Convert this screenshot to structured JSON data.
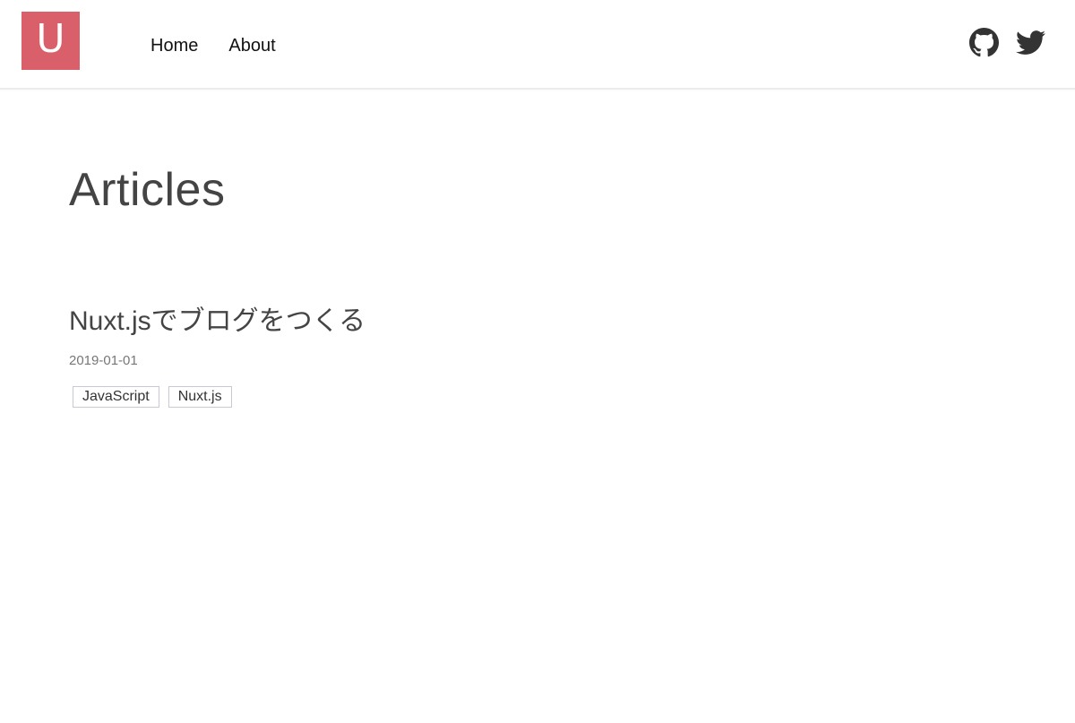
{
  "header": {
    "logo_letter": "U",
    "brand_color": "#d9606a",
    "nav": [
      {
        "label": "Home"
      },
      {
        "label": "About"
      }
    ],
    "social": [
      {
        "icon": "github-icon"
      },
      {
        "icon": "twitter-icon"
      }
    ]
  },
  "main": {
    "title": "Articles",
    "articles": [
      {
        "title": "Nuxt.jsでブログをつくる",
        "date": "2019-01-01",
        "tags": [
          "JavaScript",
          "Nuxt.js"
        ]
      }
    ]
  }
}
